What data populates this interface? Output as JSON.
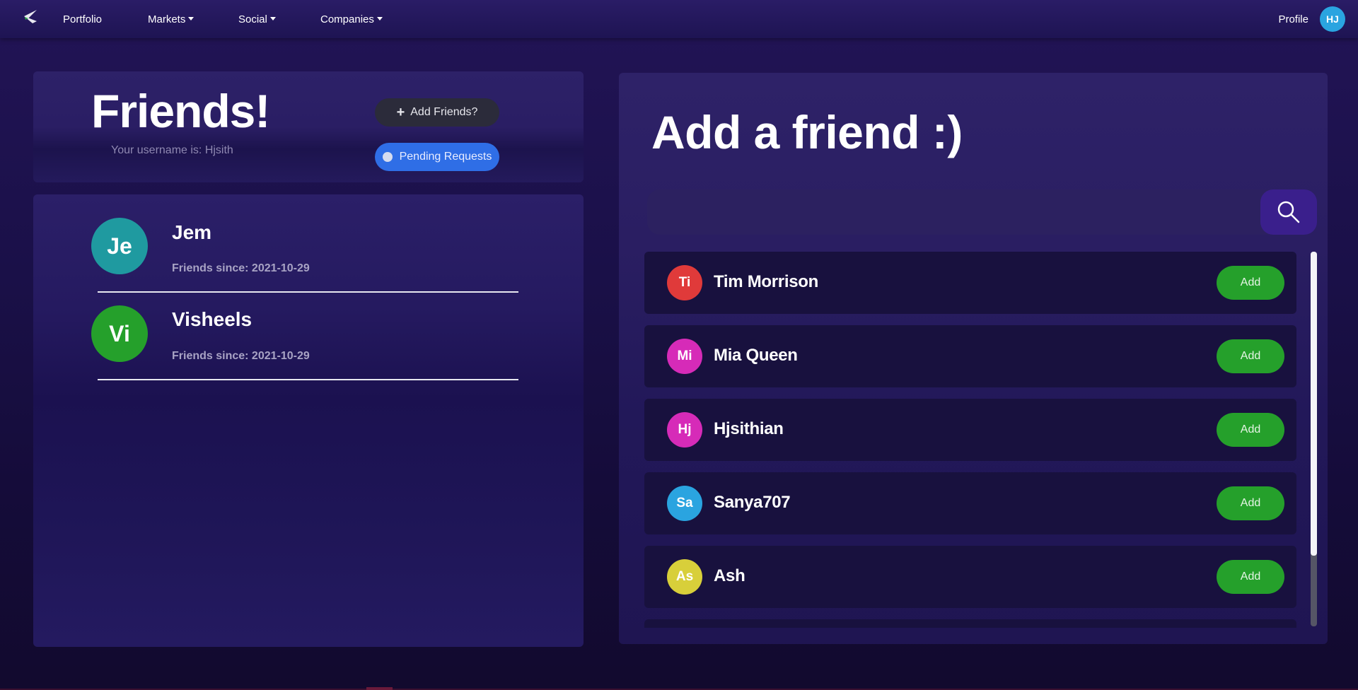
{
  "navbar": {
    "logo_icon": "stocks-s-logo-icon",
    "items": [
      {
        "label": "Portfolio",
        "dropdown": false
      },
      {
        "label": "Markets",
        "dropdown": true
      },
      {
        "label": "Social",
        "dropdown": true
      },
      {
        "label": "Companies",
        "dropdown": true
      }
    ],
    "profile_label": "Profile",
    "avatar_initials": "HJ",
    "avatar_color": "#2aa4e0"
  },
  "friends_panel": {
    "title": "Friends!",
    "username_text": "Your username is: Hjsith",
    "add_friends_label": "Add Friends?",
    "pending_requests_label": "Pending Requests"
  },
  "friends": [
    {
      "initials": "Je",
      "name": "Jem",
      "since": "Friends since: 2021-10-29",
      "color": "#1f9aa0"
    },
    {
      "initials": "Vi",
      "name": "Visheels",
      "since": "Friends since: 2021-10-29",
      "color": "#25a02b"
    }
  ],
  "add_panel": {
    "title": "Add a friend :)",
    "search_value": "",
    "search_placeholder": "",
    "add_label": "Add"
  },
  "suggestions": [
    {
      "initials": "Ti",
      "name": "Tim Morrison",
      "color": "#e03a3a"
    },
    {
      "initials": "Mi",
      "name": "Mia Queen",
      "color": "#d62bb8"
    },
    {
      "initials": "Hj",
      "name": "Hjsithian",
      "color": "#d62bb8"
    },
    {
      "initials": "Sa",
      "name": "Sanya707",
      "color": "#2aa4e0"
    },
    {
      "initials": "As",
      "name": "Ash",
      "color": "#d8cf3a"
    }
  ],
  "colors": {
    "accent_blue": "#2f6ee6",
    "add_green": "#25a02b",
    "search_button": "#3a1f8c"
  }
}
